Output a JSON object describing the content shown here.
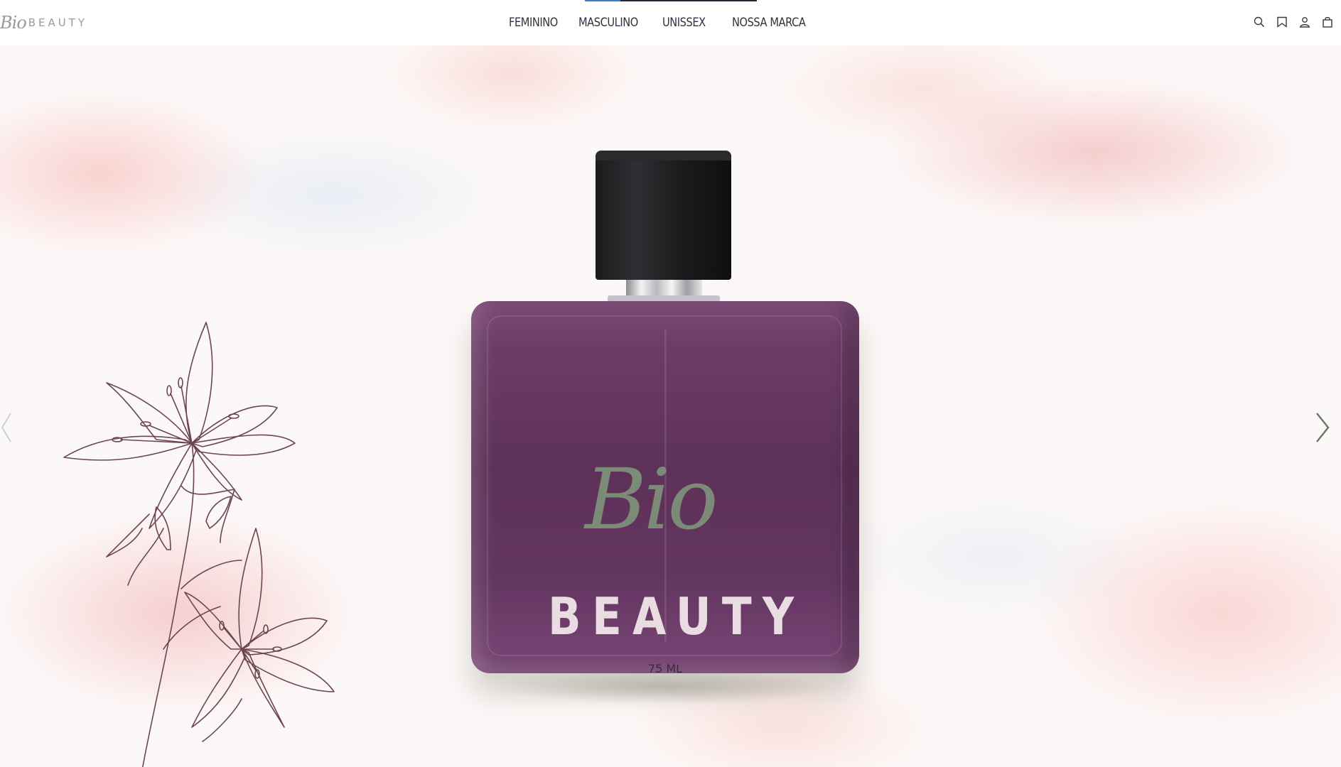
{
  "header": {
    "logo_script": "Bio",
    "logo_word": "BEAUTY",
    "nav": [
      "FEMININO",
      "MASCULINO",
      "UNISSEX",
      "NOSSA MARCA"
    ],
    "tools": [
      "search-icon",
      "bookmark-icon",
      "user-icon",
      "bag-icon"
    ]
  },
  "hero": {
    "bottle_script": "Bio",
    "bottle_word": "BEAUTY",
    "bottle_volume": "75 ML",
    "arrow_left": "chevron-left-icon",
    "arrow_right": "chevron-right-icon"
  },
  "colors": {
    "bottle": "#6c3c66",
    "cap": "#1c1c1e",
    "script": "#7b8b78",
    "nav_text": "#2b3440",
    "nav_accent": "#3a7bd5"
  }
}
